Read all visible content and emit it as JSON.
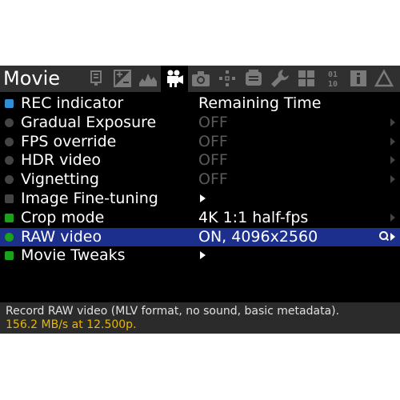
{
  "header": {
    "title": "Movie",
    "tabs": [
      {
        "name": "audio-meters-icon"
      },
      {
        "name": "exposure-icon"
      },
      {
        "name": "histogram-icon"
      },
      {
        "name": "movie-camera-icon",
        "active": true
      },
      {
        "name": "photo-camera-icon"
      },
      {
        "name": "focus-icon"
      },
      {
        "name": "display-icon"
      },
      {
        "name": "wrench-icon"
      },
      {
        "name": "modules-icon"
      },
      {
        "name": "debug-icon",
        "text": "01\n10"
      },
      {
        "name": "info-icon",
        "text": "i"
      },
      {
        "name": "triangle-icon"
      }
    ]
  },
  "menu": {
    "items": [
      {
        "label": "REC indicator",
        "value": "Remaining Time",
        "bullet": "square",
        "bullet_color": "#2f8fd8",
        "value_color": "#ffffff",
        "arrow": false
      },
      {
        "label": "Gradual Exposure",
        "value": "OFF",
        "bullet": "circle",
        "bullet_color": "#444444",
        "value_color": "#5a5a5a",
        "arrow": true
      },
      {
        "label": "FPS override",
        "value": "OFF",
        "bullet": "circle",
        "bullet_color": "#444444",
        "value_color": "#5a5a5a",
        "arrow": true
      },
      {
        "label": "HDR video",
        "value": "OFF",
        "bullet": "circle",
        "bullet_color": "#444444",
        "value_color": "#5a5a5a",
        "arrow": true
      },
      {
        "label": "Vignetting",
        "value": "OFF",
        "bullet": "circle",
        "bullet_color": "#444444",
        "value_color": "#5a5a5a",
        "arrow": true
      },
      {
        "label": "Image Fine-tuning",
        "value": "",
        "bullet": "square",
        "bullet_color": "#444444",
        "value_color": "#ffffff",
        "arrow": false,
        "submenu": true
      },
      {
        "label": "Crop mode",
        "value": "4K 1:1 half-fps",
        "bullet": "square",
        "bullet_color": "#1aa31a",
        "value_color": "#ffffff",
        "arrow": true
      },
      {
        "label": "RAW video",
        "value": "ON, 4096x2560",
        "bullet": "circle",
        "bullet_color": "#1aa31a",
        "value_color": "#ffffff",
        "arrow": true,
        "selected": true
      },
      {
        "label": "Movie Tweaks",
        "value": "",
        "bullet": "square",
        "bullet_color": "#1aa31a",
        "value_color": "#ffffff",
        "arrow": false,
        "submenu": true
      }
    ]
  },
  "help": {
    "line1": "Record RAW video (MLV format, no sound, basic metadata).",
    "line2": "156.2 MB/s at 12.500p."
  },
  "colors": {
    "selection": "#1c2f8c",
    "help_line2": "#e8b800"
  }
}
